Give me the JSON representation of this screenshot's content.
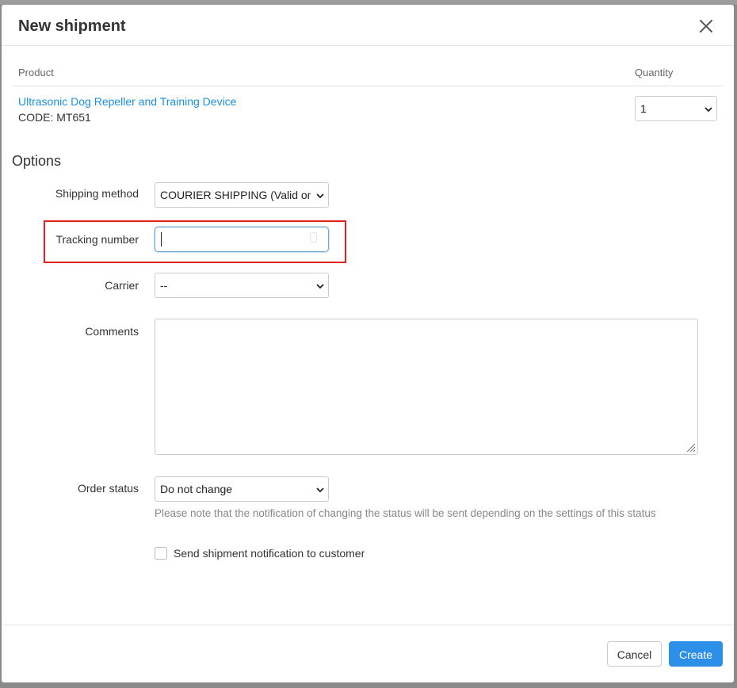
{
  "dialog": {
    "title": "New shipment",
    "close_icon": "close-icon"
  },
  "products_table": {
    "headers": {
      "product": "Product",
      "quantity": "Quantity"
    },
    "rows": [
      {
        "name": "Ultrasonic Dog Repeller and Training Device",
        "code": "CODE: MT651",
        "quantity": "1"
      }
    ]
  },
  "options": {
    "title": "Options",
    "shipping_method": {
      "label": "Shipping method",
      "value": "COURIER SHIPPING (Valid only for"
    },
    "tracking_number": {
      "label": "Tracking number",
      "value": ""
    },
    "carrier": {
      "label": "Carrier",
      "value": "--"
    },
    "comments": {
      "label": "Comments",
      "value": ""
    },
    "order_status": {
      "label": "Order status",
      "value": "Do not change",
      "note": "Please note that the notification of changing the status will be sent depending on the settings of this status"
    },
    "notify_customer": {
      "label": "Send shipment notification to customer",
      "checked": false
    }
  },
  "footer": {
    "cancel_label": "Cancel",
    "create_label": "Create"
  },
  "colors": {
    "link": "#1a8fdb",
    "primary_button": "#2d8fe8",
    "highlight": "#e01f1f"
  }
}
